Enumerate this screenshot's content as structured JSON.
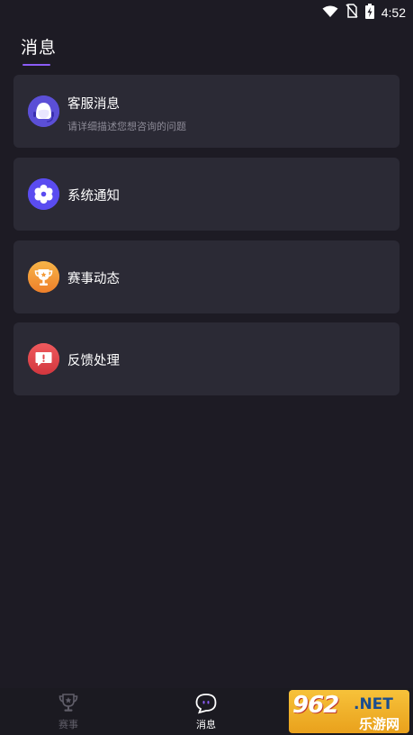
{
  "status_bar": {
    "time": "4:52",
    "icons": [
      "wifi-icon",
      "no-sim-icon",
      "battery-charging-icon"
    ]
  },
  "header": {
    "title": "消息"
  },
  "messages": [
    {
      "icon": "customer-service-icon",
      "label": "客服消息",
      "sublabel": "请详细描述您想咨询的问题",
      "color": "#5b4fd6"
    },
    {
      "icon": "system-notice-icon",
      "label": "系统通知",
      "color": "#5a4cf0"
    },
    {
      "icon": "trophy-icon",
      "label": "赛事动态",
      "color": "#f39a36"
    },
    {
      "icon": "feedback-icon",
      "label": "反馈处理",
      "color": "#e0474c"
    }
  ],
  "bottom_nav": {
    "items": [
      {
        "icon": "trophy-outline-icon",
        "label": "赛事",
        "active": false
      },
      {
        "icon": "chat-bubble-icon",
        "label": "消息",
        "active": true
      }
    ]
  },
  "watermark": {
    "number": "962",
    "suffix": ".NET",
    "site": "乐游网"
  },
  "colors": {
    "background": "#1d1b24",
    "card": "#2b2a35",
    "accent": "#8b5cf6",
    "text_secondary": "#8c8a96"
  }
}
